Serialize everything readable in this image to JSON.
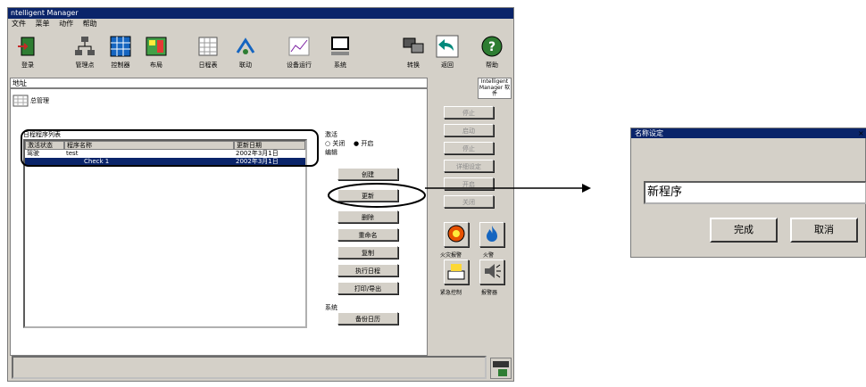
{
  "window": {
    "title": "ntelligent Manager",
    "menu": [
      "文件",
      "菜单",
      "动作",
      "帮助"
    ]
  },
  "toolbar": {
    "login": "登录",
    "manager": "管理点",
    "controller": "控制器",
    "layout": "布局",
    "schedule": "日程表",
    "linkage": "联动",
    "device_run": "设备运行",
    "system": "系统",
    "switch": "转换",
    "back": "返回",
    "help": "帮助",
    "help_box_text": "Intelligent Manager 软件"
  },
  "address_label": "地址",
  "main": {
    "tree_root": "总管理",
    "schedule_list_label": "日程程序列表",
    "columns": [
      "激活状态",
      "程序名称",
      "更新日期"
    ],
    "rows": [
      {
        "status": "驾驶",
        "name": "test",
        "date": "2002年3月1日"
      },
      {
        "status": "",
        "name": "Check 1",
        "date": "2002年3月1日"
      }
    ]
  },
  "actions": {
    "group_label": "激活",
    "opt_off": "关闭",
    "opt_on": "开启",
    "edit_label": "编辑",
    "new_btn": "创建",
    "update_btn": "更新",
    "delete_btn": "删除",
    "rename_btn": "重命名",
    "copy_btn": "复制",
    "exec_log_btn": "执行日程",
    "print_btn": "打印/导出",
    "system_label": "系统",
    "backup_btn": "备份日历"
  },
  "right_panel": {
    "btn1": "停止",
    "btn2": "启动",
    "btn3": "停止",
    "btn4": "详细设定",
    "btn5": "开启",
    "btn6": "关闭",
    "icon1_label": "火灾报警",
    "icon2_label": "火警",
    "icon3_label": "紧急控制",
    "icon4_label": "报警器"
  },
  "dialog": {
    "title": "名称设定",
    "input_value": "新程序",
    "ok_label": "完成",
    "cancel_label": "取消"
  },
  "colors": {
    "titlebar": "#0a246a",
    "face": "#d4d0c8",
    "selection": "#0a246a"
  }
}
